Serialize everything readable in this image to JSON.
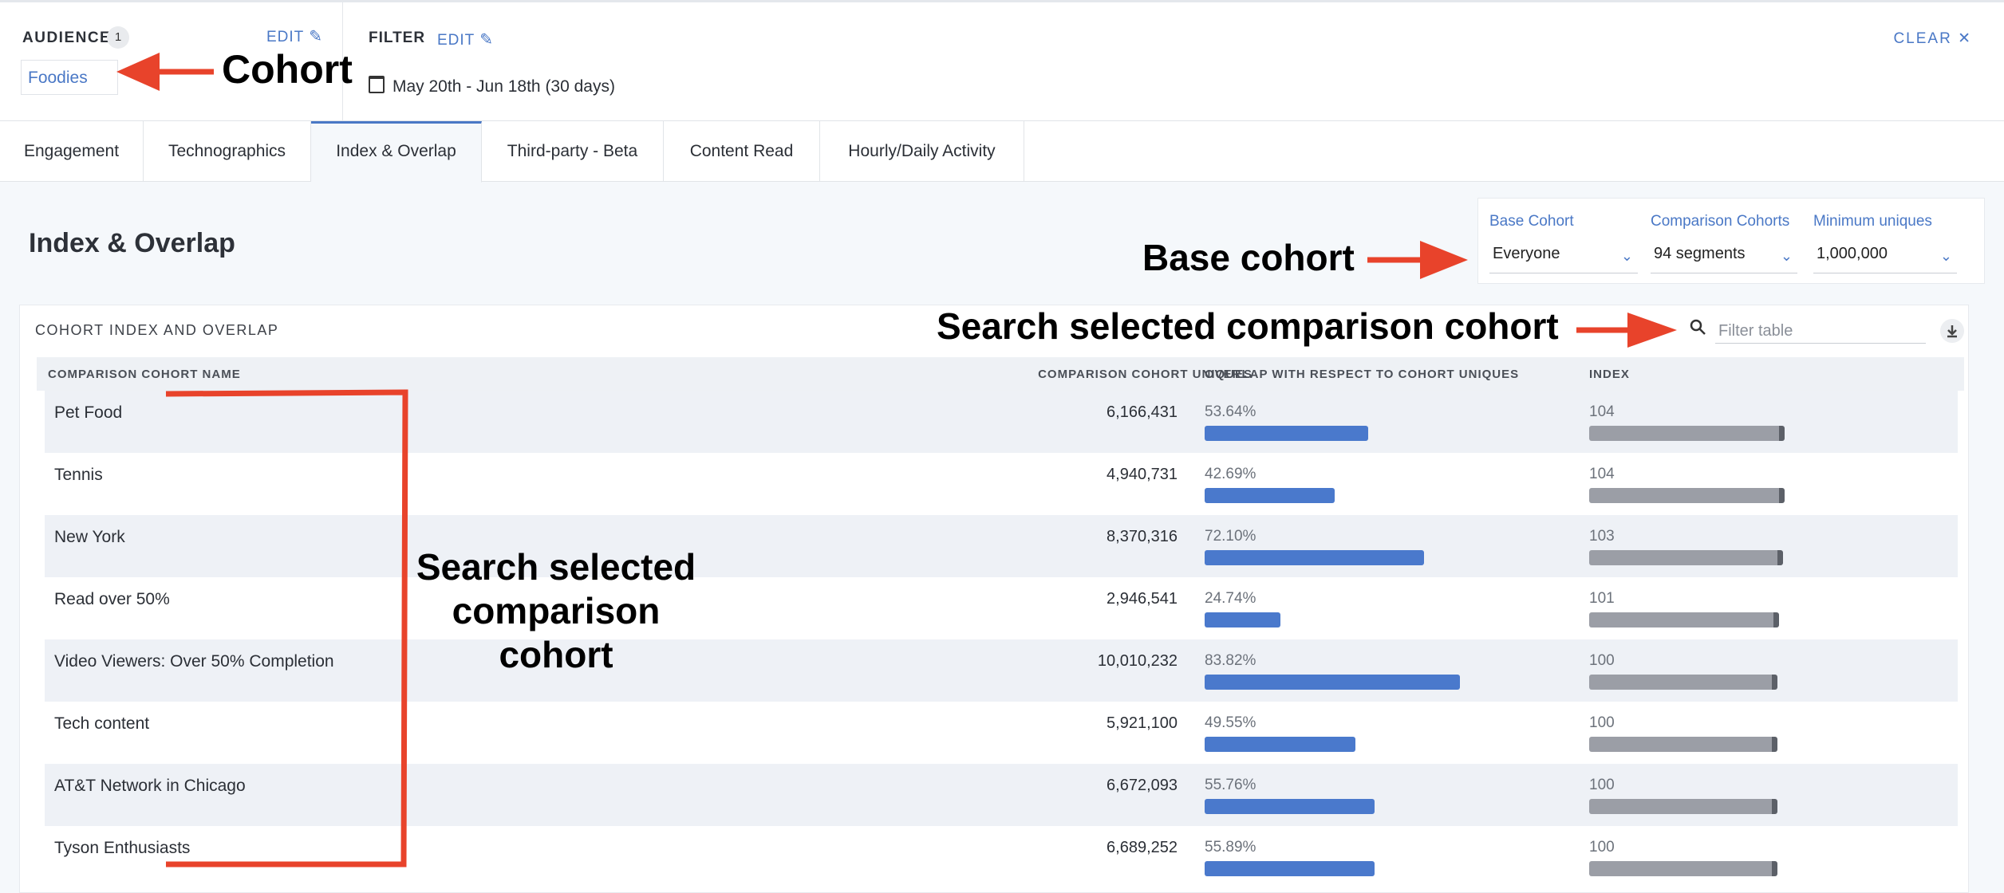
{
  "audience": {
    "title": "AUDIENCE",
    "count": "1",
    "edit_label": "EDIT",
    "cohort": "Foodies"
  },
  "filter": {
    "title": "FILTER",
    "edit_label": "EDIT",
    "date_range": "May 20th - Jun 18th (30 days)",
    "clear_label": "CLEAR"
  },
  "tabs": [
    "Engagement",
    "Technographics",
    "Index & Overlap",
    "Third-party - Beta",
    "Content Read",
    "Hourly/Daily Activity"
  ],
  "active_tab": "Index & Overlap",
  "page_title": "Index & Overlap",
  "controls": {
    "base_label": "Base Cohort",
    "base_value": "Everyone",
    "comparison_label": "Comparison Cohorts",
    "comparison_value": "94 segments",
    "minimum_label": "Minimum uniques",
    "minimum_value": "1,000,000"
  },
  "table": {
    "title": "COHORT INDEX AND OVERLAP",
    "search_placeholder": "Filter table",
    "columns": [
      "COMPARISON COHORT NAME",
      "COMPARISON COHORT UNIQUES",
      "OVERLAP WITH RESPECT TO COHORT UNIQUES",
      "INDEX"
    ],
    "rows": [
      {
        "name": "Pet Food",
        "uniques": "6,166,431",
        "overlap": "53.64%",
        "index": "104"
      },
      {
        "name": "Tennis",
        "uniques": "4,940,731",
        "overlap": "42.69%",
        "index": "104"
      },
      {
        "name": "New York",
        "uniques": "8,370,316",
        "overlap": "72.10%",
        "index": "103"
      },
      {
        "name": "Read over 50%",
        "uniques": "2,946,541",
        "overlap": "24.74%",
        "index": "101"
      },
      {
        "name": "Video Viewers: Over 50% Completion",
        "uniques": "10,010,232",
        "overlap": "83.82%",
        "index": "100"
      },
      {
        "name": "Tech content",
        "uniques": "5,921,100",
        "overlap": "49.55%",
        "index": "100"
      },
      {
        "name": "AT&T Network in Chicago",
        "uniques": "6,672,093",
        "overlap": "55.76%",
        "index": "100"
      },
      {
        "name": "Tyson Enthusiasts",
        "uniques": "6,689,252",
        "overlap": "55.89%",
        "index": "100"
      }
    ]
  },
  "annotations": {
    "cohort": "Cohort",
    "base_cohort": "Base cohort",
    "search_top": "Search selected comparison cohort",
    "search_box_lines": [
      "Search selected",
      "comparison",
      "cohort"
    ]
  },
  "colors": {
    "accent": "#4a78c6",
    "overlap_bar": "#4a79cc",
    "index_bar": "#9b9ea6",
    "annotation_arrow": "#e8432b"
  }
}
